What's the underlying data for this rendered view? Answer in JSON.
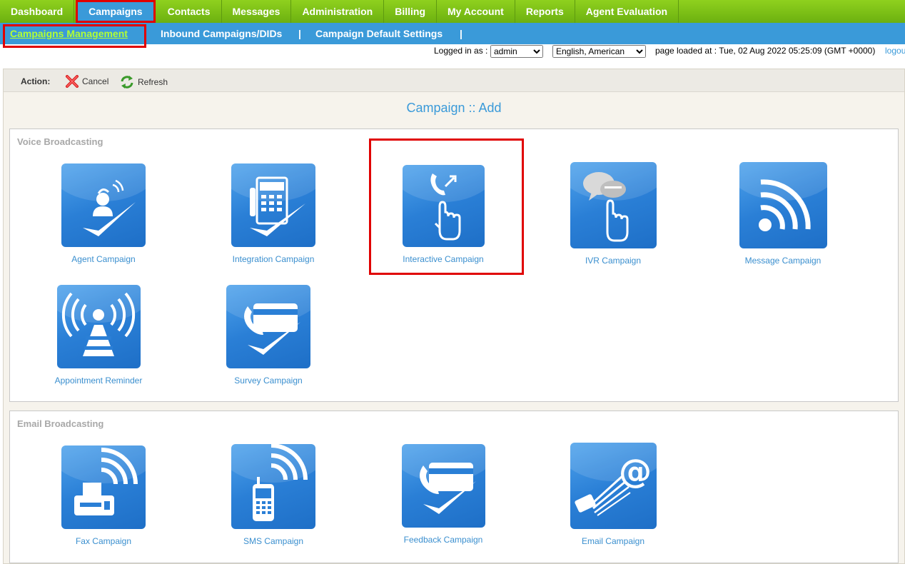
{
  "topnav": [
    "Dashboard",
    "Campaigns",
    "Contacts",
    "Messages",
    "Administration",
    "Billing",
    "My Account",
    "Reports",
    "Agent Evaluation"
  ],
  "subnav": {
    "items": [
      "Campaigns Management",
      "Inbound Campaigns/DIDs",
      "Campaign Default Settings"
    ],
    "separator": "|"
  },
  "status": {
    "logged_in_label": "Logged in as :",
    "user": "admin",
    "language": "English, American",
    "page_loaded": "page loaded at : Tue, 02 Aug 2022 05:25:09 (GMT +0000)",
    "logout": "logou"
  },
  "actionbar": {
    "label": "Action:",
    "cancel": "Cancel",
    "refresh": "Refresh"
  },
  "page_title": "Campaign :: Add",
  "sections": {
    "voice": {
      "title": "Voice Broadcasting",
      "items": [
        "Agent Campaign",
        "Integration Campaign",
        "Interactive Campaign",
        "IVR Campaign",
        "Message Campaign",
        "Appointment Reminder",
        "Survey Campaign"
      ]
    },
    "email": {
      "title": "Email Broadcasting",
      "items": [
        "Fax Campaign",
        "SMS Campaign",
        "Feedback Campaign",
        "Email Campaign"
      ]
    }
  },
  "icons": [
    "agent-icon",
    "fax-phone-icon",
    "interactive-touch-icon",
    "ivr-chat-icon",
    "wireless-signal-icon",
    "broadcast-tower-icon",
    "survey-card-icon",
    "fax-machine-icon",
    "mobile-phone-icon",
    "feedback-card-icon",
    "email-at-icon"
  ],
  "colors": {
    "nav_green": "#7ec21a",
    "nav_blue": "#3a9ad9",
    "highlight_red": "#e00000",
    "link_blue": "#3a8fcf"
  }
}
